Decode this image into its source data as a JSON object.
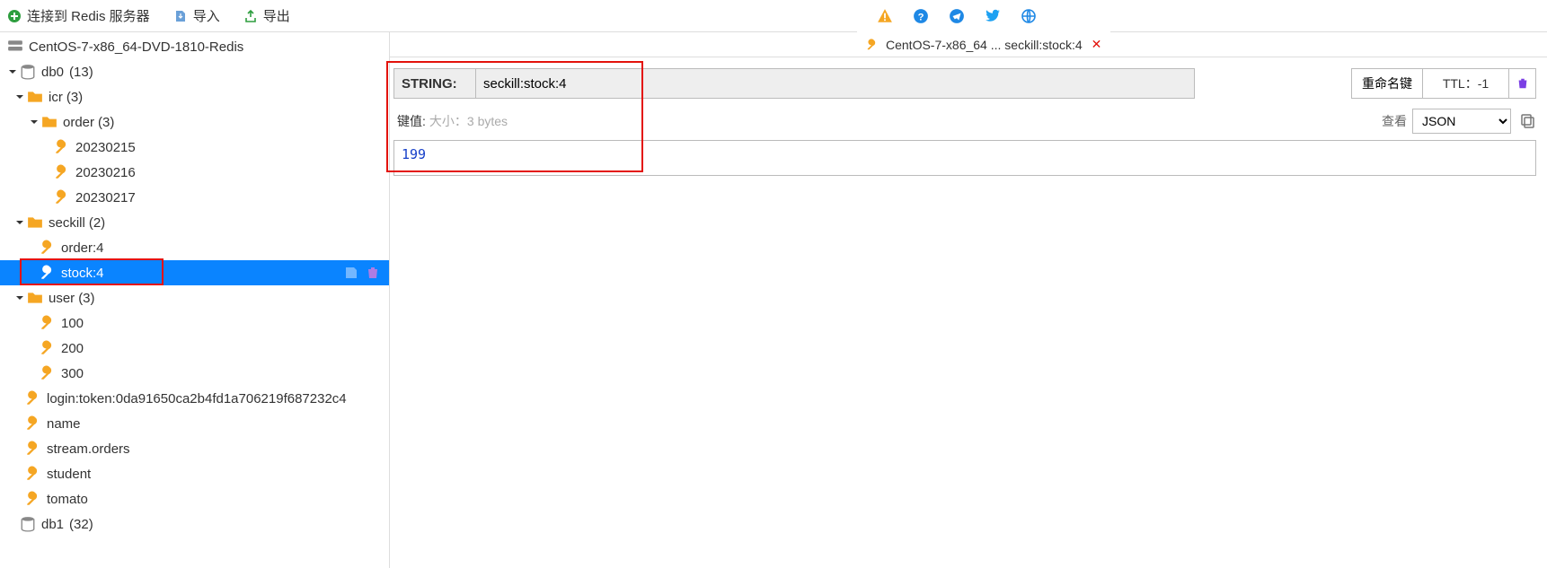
{
  "toolbar": {
    "connect_label": "连接到 Redis 服务器",
    "import_label": "导入",
    "export_label": "导出"
  },
  "tree": {
    "server": "CentOS-7-x86_64-DVD-1810-Redis",
    "db0": {
      "label": "db0",
      "count": "(13)"
    },
    "icr": {
      "label": "icr",
      "count": "(3)"
    },
    "order_folder": {
      "label": "order",
      "count": "(3)"
    },
    "order_keys": [
      "20230215",
      "20230216",
      "20230217"
    ],
    "seckill": {
      "label": "seckill",
      "count": "(2)"
    },
    "seckill_keys": [
      "order:4",
      "stock:4"
    ],
    "user": {
      "label": "user",
      "count": "(3)"
    },
    "user_keys": [
      "100",
      "200",
      "300"
    ],
    "root_keys": [
      "login:token:0da91650ca2b4fd1a706219f687232c4",
      "name",
      "stream.orders",
      "student",
      "tomato"
    ],
    "db1": {
      "label": "db1",
      "count": "(32)"
    }
  },
  "tab": {
    "title": "CentOS-7-x86_64 ... seckill:stock:4"
  },
  "detail": {
    "type_label": "STRING:",
    "key_name": "seckill:stock:4",
    "rename_label": "重命名键",
    "ttl_label": "TTL：-1",
    "value_label": "键值:",
    "size_label": "大小：3 bytes",
    "view_label": "查看",
    "view_mode": "JSON",
    "value": "199"
  }
}
